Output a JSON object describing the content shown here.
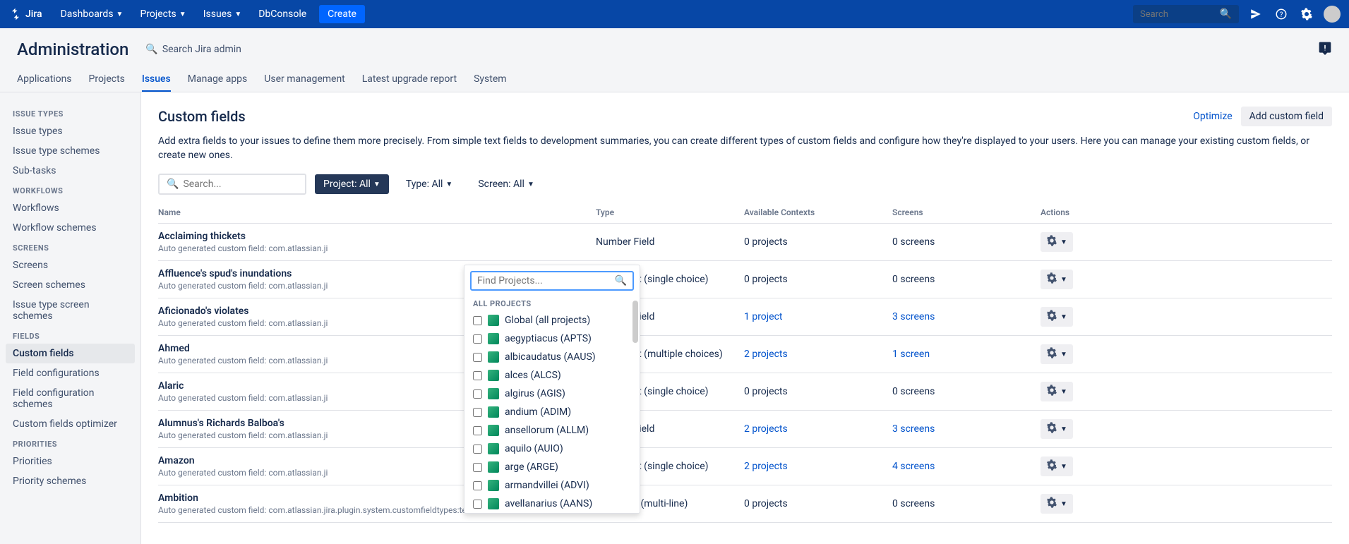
{
  "topnav": {
    "logo": "Jira",
    "items": [
      "Dashboards",
      "Projects",
      "Issues",
      "DbConsole"
    ],
    "create": "Create",
    "search_placeholder": "Search"
  },
  "admin": {
    "title": "Administration",
    "search": "Search Jira admin"
  },
  "tabs": [
    "Applications",
    "Projects",
    "Issues",
    "Manage apps",
    "User management",
    "Latest upgrade report",
    "System"
  ],
  "active_tab": 2,
  "sidebar": {
    "groups": [
      {
        "heading": "ISSUE TYPES",
        "items": [
          "Issue types",
          "Issue type schemes",
          "Sub-tasks"
        ]
      },
      {
        "heading": "WORKFLOWS",
        "items": [
          "Workflows",
          "Workflow schemes"
        ]
      },
      {
        "heading": "SCREENS",
        "items": [
          "Screens",
          "Screen schemes",
          "Issue type screen schemes"
        ]
      },
      {
        "heading": "FIELDS",
        "items": [
          "Custom fields",
          "Field configurations",
          "Field configuration schemes",
          "Custom fields optimizer"
        ]
      },
      {
        "heading": "PRIORITIES",
        "items": [
          "Priorities",
          "Priority schemes"
        ]
      }
    ],
    "active": "Custom fields"
  },
  "page": {
    "title": "Custom fields",
    "optimize": "Optimize",
    "add": "Add custom field",
    "description": "Add extra fields to your issues to define them more precisely. From simple text fields to development summaries, you can create different types of custom fields and configure how they're displayed to your users. Here you can manage your existing custom fields, or create new ones."
  },
  "filters": {
    "search_placeholder": "Search...",
    "project": "Project: All",
    "type": "Type: All",
    "screen": "Screen: All"
  },
  "table": {
    "headers": {
      "name": "Name",
      "type": "Type",
      "ctx": "Available Contexts",
      "scr": "Screens",
      "act": "Actions"
    },
    "rows": [
      {
        "name": "Acclaiming thickets",
        "sub": "Auto generated custom field: com.atlassian.ji",
        "type": "Number Field",
        "ctx": "0 projects",
        "ctx_link": false,
        "scr": "0 screens",
        "scr_link": false
      },
      {
        "name": "Affluence's spud's inundations",
        "sub": "Auto generated custom field: com.atlassian.ji",
        "type": "Select List (single choice)",
        "ctx": "0 projects",
        "ctx_link": false,
        "scr": "0 screens",
        "scr_link": false
      },
      {
        "name": "Aficionado's violates",
        "sub": "Auto generated custom field: com.atlassian.ji",
        "type": "Number Field",
        "ctx": "1 project",
        "ctx_link": true,
        "scr": "3 screens",
        "scr_link": true
      },
      {
        "name": "Ahmed",
        "sub": "Auto generated custom field: com.atlassian.ji",
        "type": "Select List (multiple choices)",
        "ctx": "2 projects",
        "ctx_link": true,
        "scr": "1 screen",
        "scr_link": true
      },
      {
        "name": "Alaric",
        "sub": "Auto generated custom field: com.atlassian.ji",
        "type": "Select List (single choice)",
        "ctx": "0 projects",
        "ctx_link": false,
        "scr": "0 screens",
        "scr_link": false
      },
      {
        "name": "Alumnus's Richards Balboa's",
        "sub": "Auto generated custom field: com.atlassian.ji",
        "type": "Number Field",
        "ctx": "2 projects",
        "ctx_link": true,
        "scr": "3 screens",
        "scr_link": true
      },
      {
        "name": "Amazon",
        "sub": "Auto generated custom field: com.atlassian.ji",
        "type": "Select List (single choice)",
        "ctx": "2 projects",
        "ctx_link": true,
        "scr": "4 screens",
        "scr_link": true
      },
      {
        "name": "Ambition",
        "sub": "Auto generated custom field: com.atlassian.jira.plugin.system.customfieldtypes:textarea",
        "type": "Text Field (multi-line)",
        "ctx": "0 projects",
        "ctx_link": false,
        "scr": "0 screens",
        "scr_link": false
      }
    ]
  },
  "dropdown": {
    "placeholder": "Find Projects...",
    "heading": "ALL PROJECTS",
    "items": [
      "Global (all projects)",
      "aegyptiacus (APTS)",
      "albicaudatus (AAUS)",
      "alces (ALCS)",
      "algirus (AGIS)",
      "andium (ADIM)",
      "ansellorum (ALLM)",
      "aquilo (AUIO)",
      "arge (ARGE)",
      "armandvillei (ADVI)",
      "avellanarius (AANS)"
    ]
  }
}
